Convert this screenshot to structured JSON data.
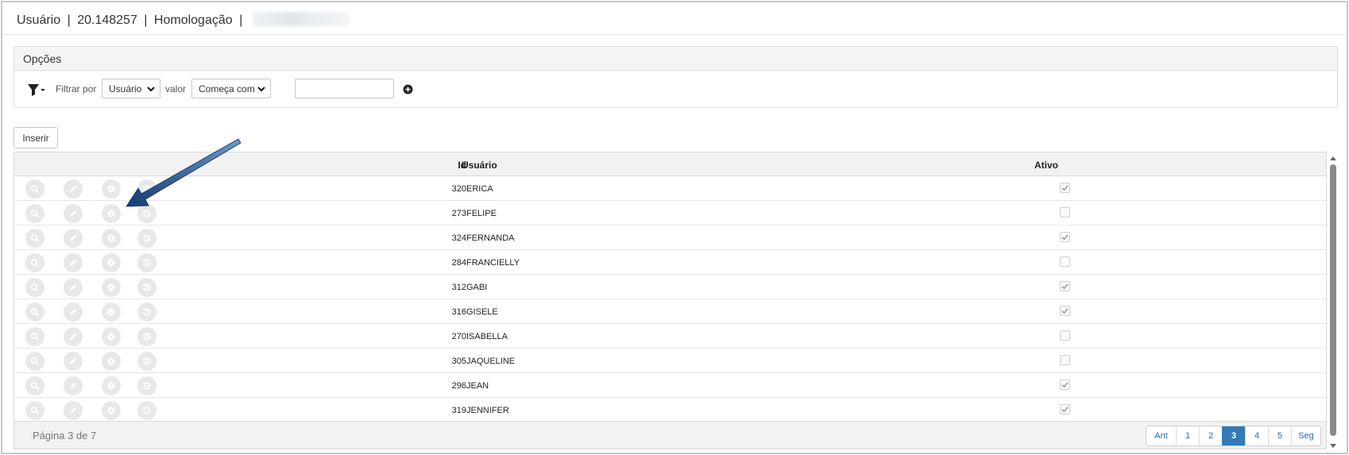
{
  "window": {
    "title_user": "Usuário",
    "title_id": "20.148257",
    "title_env": "Homologação",
    "separator": "|"
  },
  "options": {
    "header": "Opções",
    "filter_icon": "filter-dropdown-icon",
    "filter_by_label": "Filtrar por",
    "filter_by_value": "Usuário",
    "value_label": "valor",
    "operator_value": "Começa com",
    "value_input": "",
    "add_icon": "plus-circle-icon"
  },
  "toolbar": {
    "insert_label": "Inserir"
  },
  "table": {
    "columns": {
      "id": "Id",
      "user": "Usuário",
      "active": "Ativo"
    },
    "action_icons": [
      "search-icon",
      "pencil-icon",
      "gear-icon",
      "history-icon"
    ],
    "rows": [
      {
        "id": "320",
        "user": "ERICA",
        "active": true
      },
      {
        "id": "273",
        "user": "FELIPE",
        "active": false
      },
      {
        "id": "324",
        "user": "FERNANDA",
        "active": true
      },
      {
        "id": "284",
        "user": "FRANCIELLY",
        "active": false
      },
      {
        "id": "312",
        "user": "GABI",
        "active": true
      },
      {
        "id": "316",
        "user": "GISELE",
        "active": true
      },
      {
        "id": "270",
        "user": "ISABELLA",
        "active": false
      },
      {
        "id": "305",
        "user": "JAQUELINE",
        "active": false
      },
      {
        "id": "296",
        "user": "JEAN",
        "active": true
      },
      {
        "id": "319",
        "user": "JENNIFER",
        "active": true
      }
    ]
  },
  "footer": {
    "page_info": "Página 3 de 7",
    "pager": [
      "Ant",
      "1",
      "2",
      "3",
      "4",
      "5",
      "Seg"
    ],
    "current_page": "3"
  },
  "colors": {
    "accent": "#337ab7",
    "annotation_arrow": "#1f4e8c"
  }
}
